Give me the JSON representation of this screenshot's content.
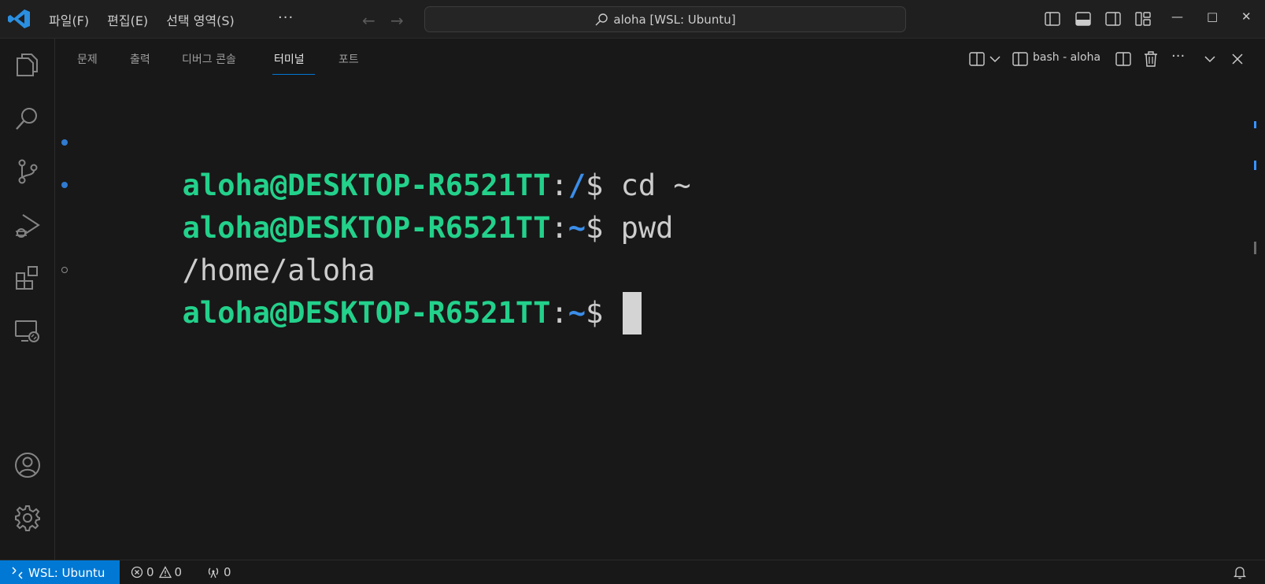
{
  "menu": {
    "items": [
      "파일(F)",
      "편집(E)",
      "선택 영역(S)"
    ],
    "more": "···"
  },
  "command_center": {
    "text": "aloha [WSL: Ubuntu]"
  },
  "panel": {
    "tabs": [
      "문제",
      "출력",
      "디버그 콘솔",
      "터미널",
      "포트"
    ],
    "active_tab": "터미널",
    "terminal_instance": "bash - aloha"
  },
  "terminal": {
    "lines": [
      {
        "user": "aloha@DESKTOP-R6521TT",
        "colon": ":",
        "path": "/",
        "dollar": "$",
        "command": " cd ~",
        "status": "done"
      },
      {
        "user": "aloha@DESKTOP-R6521TT",
        "colon": ":",
        "path": "~",
        "dollar": "$",
        "command": " pwd",
        "status": "done"
      },
      {
        "output": "/home/aloha"
      },
      {
        "user": "aloha@DESKTOP-R6521TT",
        "colon": ":",
        "path": "~",
        "dollar": "$",
        "command": " ",
        "status": "pending"
      }
    ]
  },
  "statusbar": {
    "remote": "WSL: Ubuntu",
    "errors": "0",
    "warnings": "0",
    "ports": "0"
  },
  "colors": {
    "accent": "#0078d4",
    "prompt_green": "#23d18b",
    "path_blue": "#3b8eea",
    "background": "#181818"
  },
  "icons": [
    "vscode-logo-icon",
    "search-icon",
    "arrow-left-icon",
    "arrow-right-icon",
    "toggle-primary-sidebar-icon",
    "toggle-panel-icon",
    "toggle-secondary-sidebar-icon",
    "customize-layout-icon",
    "minimize-icon",
    "maximize-icon",
    "close-icon",
    "explorer-icon",
    "source-control-icon",
    "run-debug-icon",
    "extensions-icon",
    "remote-explorer-icon",
    "accounts-icon",
    "settings-gear-icon",
    "split-terminal-icon",
    "chevron-down-icon",
    "terminal-split-icon",
    "trash-icon",
    "more-actions-icon",
    "remote-icon",
    "error-icon",
    "warning-icon",
    "ports-icon",
    "bell-icon"
  ]
}
